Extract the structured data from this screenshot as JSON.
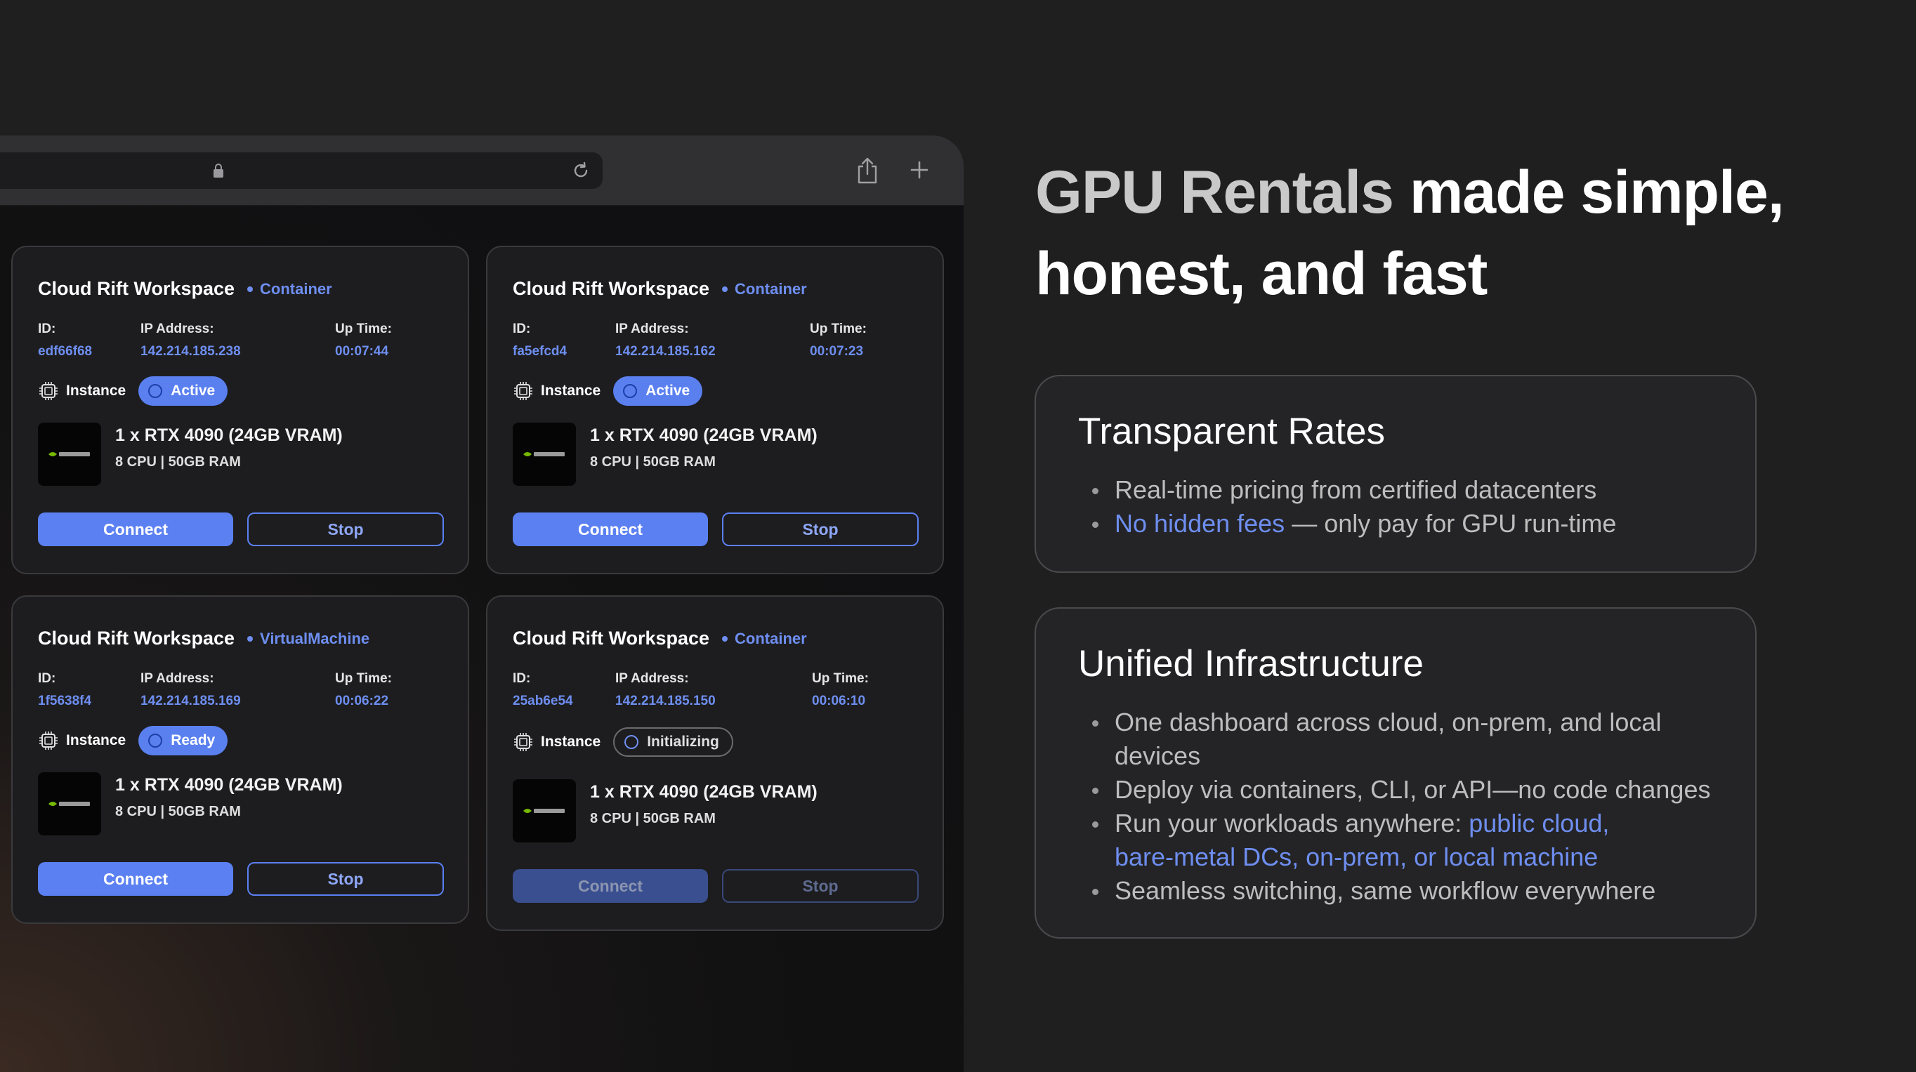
{
  "headline": {
    "line1_muted": "GPU Rentals",
    "line1_bright": " made simple,",
    "line2_bright": "honest, and fast"
  },
  "browser": {
    "icons": [
      "lock-icon",
      "reload-icon",
      "share-icon",
      "plus-icon"
    ]
  },
  "labels": {
    "id": "ID:",
    "ip": "IP Address:",
    "uptime": "Up Time:",
    "instance": "Instance",
    "connect": "Connect",
    "stop": "Stop"
  },
  "cards": [
    {
      "title": "Cloud Rift Workspace",
      "type": "Container",
      "id": "edf66f68",
      "ip": "142.214.185.238",
      "uptime": "00:07:44",
      "status": "Active",
      "gpu": "1 x RTX 4090 (24GB VRAM)",
      "spec": "8 CPU | 50GB RAM"
    },
    {
      "title": "Cloud Rift Workspace",
      "type": "Container",
      "id": "fa5efcd4",
      "ip": "142.214.185.162",
      "uptime": "00:07:23",
      "status": "Active",
      "gpu": "1 x RTX 4090 (24GB VRAM)",
      "spec": "8 CPU | 50GB RAM"
    },
    {
      "title": "Cloud Rift Workspace",
      "type": "VirtualMachine",
      "id": "1f5638f4",
      "ip": "142.214.185.169",
      "uptime": "00:06:22",
      "status": "Ready",
      "gpu": "1 x RTX 4090 (24GB VRAM)",
      "spec": "8 CPU | 50GB RAM"
    },
    {
      "title": "Cloud Rift Workspace",
      "type": "Container",
      "id": "25ab6e54",
      "ip": "142.214.185.150",
      "uptime": "00:06:10",
      "status": "Initializing",
      "gpu": "1 x RTX 4090 (24GB VRAM)",
      "spec": "8 CPU | 50GB RAM"
    }
  ],
  "features": {
    "rates": {
      "title": "Transparent Rates",
      "item1": "Real-time pricing from certified datacenters",
      "item2_accent": "No hidden fees",
      "item2_rest": " — only pay for GPU run-time"
    },
    "infra": {
      "title": "Unified Infrastructure",
      "item1_line1": "One dashboard across cloud, on-prem, and local",
      "item1_line2": "devices",
      "item2": "Deploy via containers, CLI, or API—no code changes",
      "item3_plain": "Run your workloads anywhere: ",
      "item3_accent1": "public cloud,",
      "item3_accent2": "bare-metal DCs, on-prem, or local machine",
      "item4": "Seamless switching, same workflow everywhere"
    }
  },
  "colors": {
    "accent": "#6e8ef0",
    "button": "#5b80f2",
    "background": "#1f1f20"
  }
}
